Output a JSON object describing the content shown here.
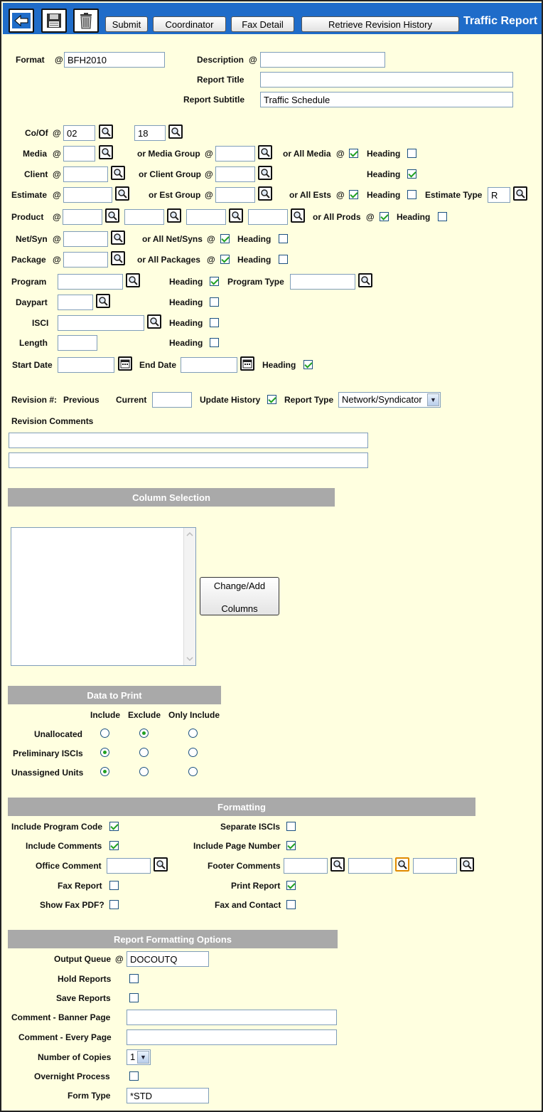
{
  "app": {
    "title": "Traffic Report"
  },
  "toolbar": {
    "submit": "Submit",
    "coordinator": "Coordinator",
    "fax_detail": "Fax Detail",
    "retrieve": "Retrieve Revision History"
  },
  "at": "@",
  "header_fields": {
    "format_label": "Format",
    "format_value": "BFH2010",
    "description_label": "Description",
    "description_value": "",
    "report_title_label": "Report Title",
    "report_title_value": "",
    "report_subtitle_label": "Report Subtitle",
    "report_subtitle_value": "Traffic Schedule"
  },
  "filters": {
    "coof_label": "Co/Of",
    "coof_value1": "02",
    "coof_value2": "18",
    "media_label": "Media",
    "or_media_group": "or Media Group",
    "or_all_media": "or All Media",
    "client_label": "Client",
    "or_client_group": "or Client Group",
    "estimate_label": "Estimate",
    "or_est_group": "or Est Group",
    "or_all_ests": "or All Ests",
    "estimate_type_label": "Estimate Type",
    "estimate_type_value": "R",
    "product_label": "Product",
    "or_all_prods": "or All Prods",
    "netsyn_label": "Net/Syn",
    "or_all_netsyns": "or All Net/Syns",
    "package_label": "Package",
    "or_all_packages": "or All Packages",
    "program_label": "Program",
    "program_type_label": "Program Type",
    "daypart_label": "Daypart",
    "isci_label": "ISCI",
    "length_label": "Length",
    "start_date_label": "Start Date",
    "end_date_label": "End Date",
    "heading": "Heading"
  },
  "revision": {
    "revision_label": "Revision #:",
    "previous_label": "Previous",
    "current_label": "Current",
    "current_value": "",
    "update_history_label": "Update History",
    "report_type_label": "Report Type",
    "report_type_value": "Network/Syndicator",
    "comments_label": "Revision Comments"
  },
  "column_selection": {
    "title": "Column Selection",
    "button_line1": "Change/Add",
    "button_line2": "Columns"
  },
  "data_to_print": {
    "title": "Data to Print",
    "columns": [
      "Include",
      "Exclude",
      "Only Include"
    ],
    "rows": [
      {
        "label": "Unallocated",
        "selected": 1
      },
      {
        "label": "Preliminary ISCIs",
        "selected": 0
      },
      {
        "label": "Unassigned Units",
        "selected": 0
      }
    ]
  },
  "formatting": {
    "title": "Formatting",
    "include_program_code": "Include Program Code",
    "separate_iscis": "Separate ISCIs",
    "include_comments": "Include Comments",
    "include_page_number": "Include Page Number",
    "office_comment": "Office Comment",
    "footer_comments": "Footer Comments",
    "fax_report": "Fax Report",
    "print_report": "Print Report",
    "show_fax_pdf": "Show Fax PDF?",
    "fax_and_contact": "Fax and Contact"
  },
  "report_options": {
    "title": "Report Formatting Options",
    "output_queue_label": "Output Queue",
    "output_queue_value": "DOCOUTQ",
    "hold_reports": "Hold Reports",
    "save_reports": "Save Reports",
    "comment_banner": "Comment - Banner Page",
    "comment_every": "Comment - Every Page",
    "num_copies_label": "Number of Copies",
    "num_copies_value": "1",
    "overnight": "Overnight Process",
    "form_type_label": "Form Type",
    "form_type_value": "*STD"
  },
  "colors": {
    "toolbar": "#1f6cc9",
    "background": "#ffffe0",
    "section": "#a9a9a9",
    "check": "#21a121"
  }
}
